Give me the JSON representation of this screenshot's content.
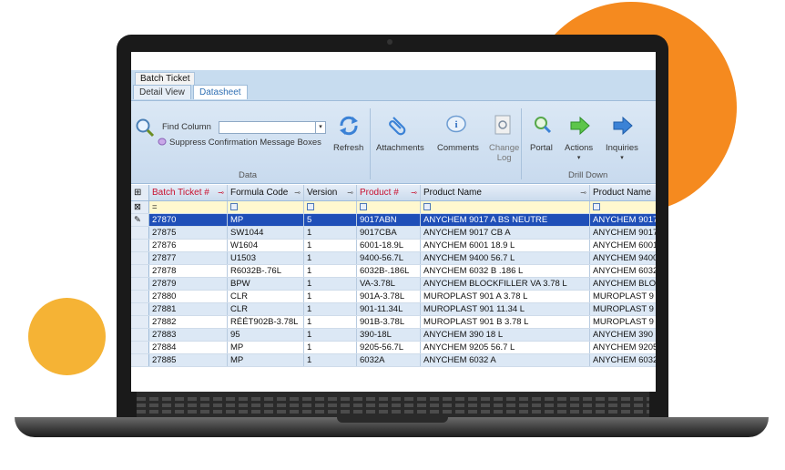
{
  "colors": {
    "orange_circle": "#f58a1f",
    "yellow_circle": "#f5b335",
    "selected_row": "#1f4fb8",
    "ribbon": "#c8daee"
  },
  "document_tab": "Batch Ticket",
  "view_tabs": [
    {
      "label": "Detail View"
    },
    {
      "label": "Datasheet"
    }
  ],
  "ribbon": {
    "find_column_label": "Find Column",
    "find_column_value": "",
    "suppress_label": "Suppress Confirmation Message Boxes",
    "refresh_label": "Refresh",
    "data_group": "Data",
    "attachments_label": "Attachments",
    "comments_label": "Comments",
    "change_log_label1": "Change",
    "change_log_label2": "Log",
    "portal_label": "Portal",
    "actions_label": "Actions",
    "inquiries_label": "Inquiries",
    "drill_down_group": "Drill Down"
  },
  "grid": {
    "columns": [
      "Batch Ticket #",
      "Formula Code",
      "Version",
      "Product #",
      "Product  Name",
      "Product Name"
    ],
    "filter_first": "=",
    "rows": [
      {
        "batch": "27870",
        "formula": "MP",
        "version": "5",
        "product": "9017ABN",
        "name": "ANYCHEM 9017 A BS NEUTRE",
        "name2": "ANYCHEM 9017"
      },
      {
        "batch": "27875",
        "formula": "SW1044",
        "version": "1",
        "product": "9017CBA",
        "name": "ANYCHEM 9017 CB A",
        "name2": "ANYCHEM 9017"
      },
      {
        "batch": "27876",
        "formula": "W1604",
        "version": "1",
        "product": "6001-18.9L",
        "name": "ANYCHEM 6001 18.9 L",
        "name2": "ANYCHEM 6001"
      },
      {
        "batch": "27877",
        "formula": "U1503",
        "version": "1",
        "product": "9400-56.7L",
        "name": "ANYCHEM 9400 56.7 L",
        "name2": "ANYCHEM 9400"
      },
      {
        "batch": "27878",
        "formula": "R6032B-.76L",
        "version": "1",
        "product": "6032B-.186L",
        "name": "ANYCHEM 6032 B .186 L",
        "name2": "ANYCHEM 6032"
      },
      {
        "batch": "27879",
        "formula": "BPW",
        "version": "1",
        "product": "VA-3.78L",
        "name": "ANYCHEM BLOCKFILLER VA 3.78 L",
        "name2": "ANYCHEM BLO"
      },
      {
        "batch": "27880",
        "formula": "CLR",
        "version": "1",
        "product": "901A-3.78L",
        "name": "MUROPLAST 901 A 3.78 L",
        "name2": "MUROPLAST 9"
      },
      {
        "batch": "27881",
        "formula": "CLR",
        "version": "1",
        "product": "901-11.34L",
        "name": "MUROPLAST 901 11.34 L",
        "name2": "MUROPLAST 9"
      },
      {
        "batch": "27882",
        "formula": "RÉÉT902B-3.78L",
        "version": "1",
        "product": "901B-3.78L",
        "name": "MUROPLAST 901 B 3.78 L",
        "name2": "MUROPLAST 9"
      },
      {
        "batch": "27883",
        "formula": "95",
        "version": "1",
        "product": "390-18L",
        "name": "ANYCHEM 390 18 L",
        "name2": "ANYCHEM 390"
      },
      {
        "batch": "27884",
        "formula": "MP",
        "version": "1",
        "product": "9205-56.7L",
        "name": "ANYCHEM 9205 56.7 L",
        "name2": "ANYCHEM 9205"
      },
      {
        "batch": "27885",
        "formula": "MP",
        "version": "1",
        "product": "6032A",
        "name": "ANYCHEM 6032 A",
        "name2": "ANYCHEM 6032"
      }
    ]
  }
}
